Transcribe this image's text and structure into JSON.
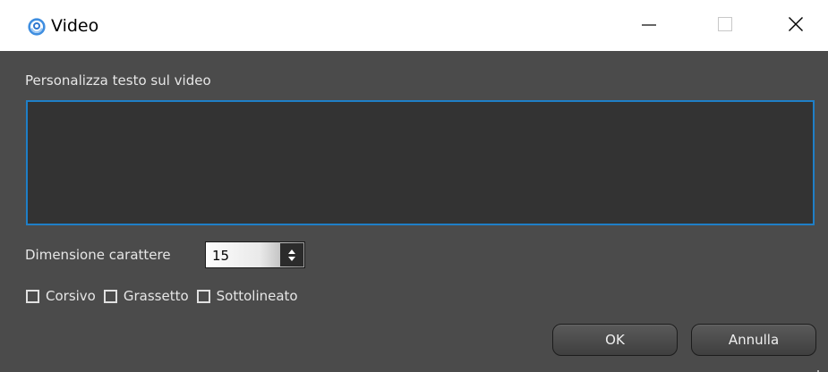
{
  "window": {
    "title": "Video",
    "app_icon": "swirl-logo-icon",
    "controls": {
      "minimize_icon": "minimize-icon",
      "maximize_icon": "maximize-icon",
      "close_icon": "close-icon"
    }
  },
  "form": {
    "text_label": "Personalizza testo sul video",
    "text_value": "",
    "font_size_label": "Dimensione carattere",
    "font_size_value": "15",
    "options": [
      {
        "label": "Corsivo",
        "checked": false
      },
      {
        "label": "Grassetto",
        "checked": false
      },
      {
        "label": "Sottolineato",
        "checked": false
      }
    ]
  },
  "buttons": {
    "ok_label": "OK",
    "cancel_label": "Annulla"
  },
  "colors": {
    "body_background": "#4b4b4b",
    "text_area_background": "#333333",
    "focus_border": "#1f7fc7",
    "title_bar": "#ffffff"
  }
}
